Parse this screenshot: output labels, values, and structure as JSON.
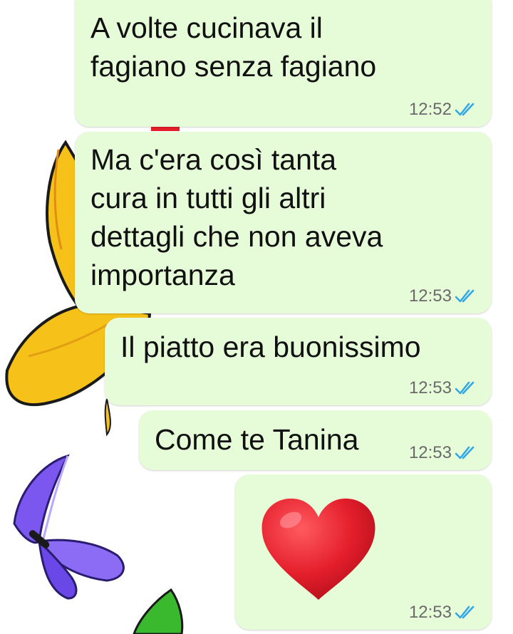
{
  "chat": {
    "messages": [
      {
        "text": "A volte cucinava il\nfagiano senza fagiano",
        "time": "12:52",
        "status_icon": "double-check-read-icon"
      },
      {
        "text": "Ma c'era così tanta\ncura in tutti gli altri\ndettagli che non aveva\nimportanza",
        "time": "12:53",
        "status_icon": "double-check-read-icon"
      },
      {
        "text": "Il piatto era buonissimo",
        "time": "12:53",
        "status_icon": "double-check-read-icon"
      },
      {
        "text": "Come te Tanina",
        "time": "12:53",
        "status_icon": "double-check-read-icon"
      },
      {
        "emoji": "heart-icon",
        "time": "12:53",
        "status_icon": "double-check-read-icon"
      }
    ]
  },
  "colors": {
    "bubble_outgoing": "#e6fbd8",
    "read_ticks": "#34a8e6",
    "heart": "#e41e2b"
  },
  "wallpaper": {
    "decorations": [
      "yellow-butterfly-icon",
      "purple-butterfly-icon",
      "green-butterfly-wing-icon"
    ]
  }
}
